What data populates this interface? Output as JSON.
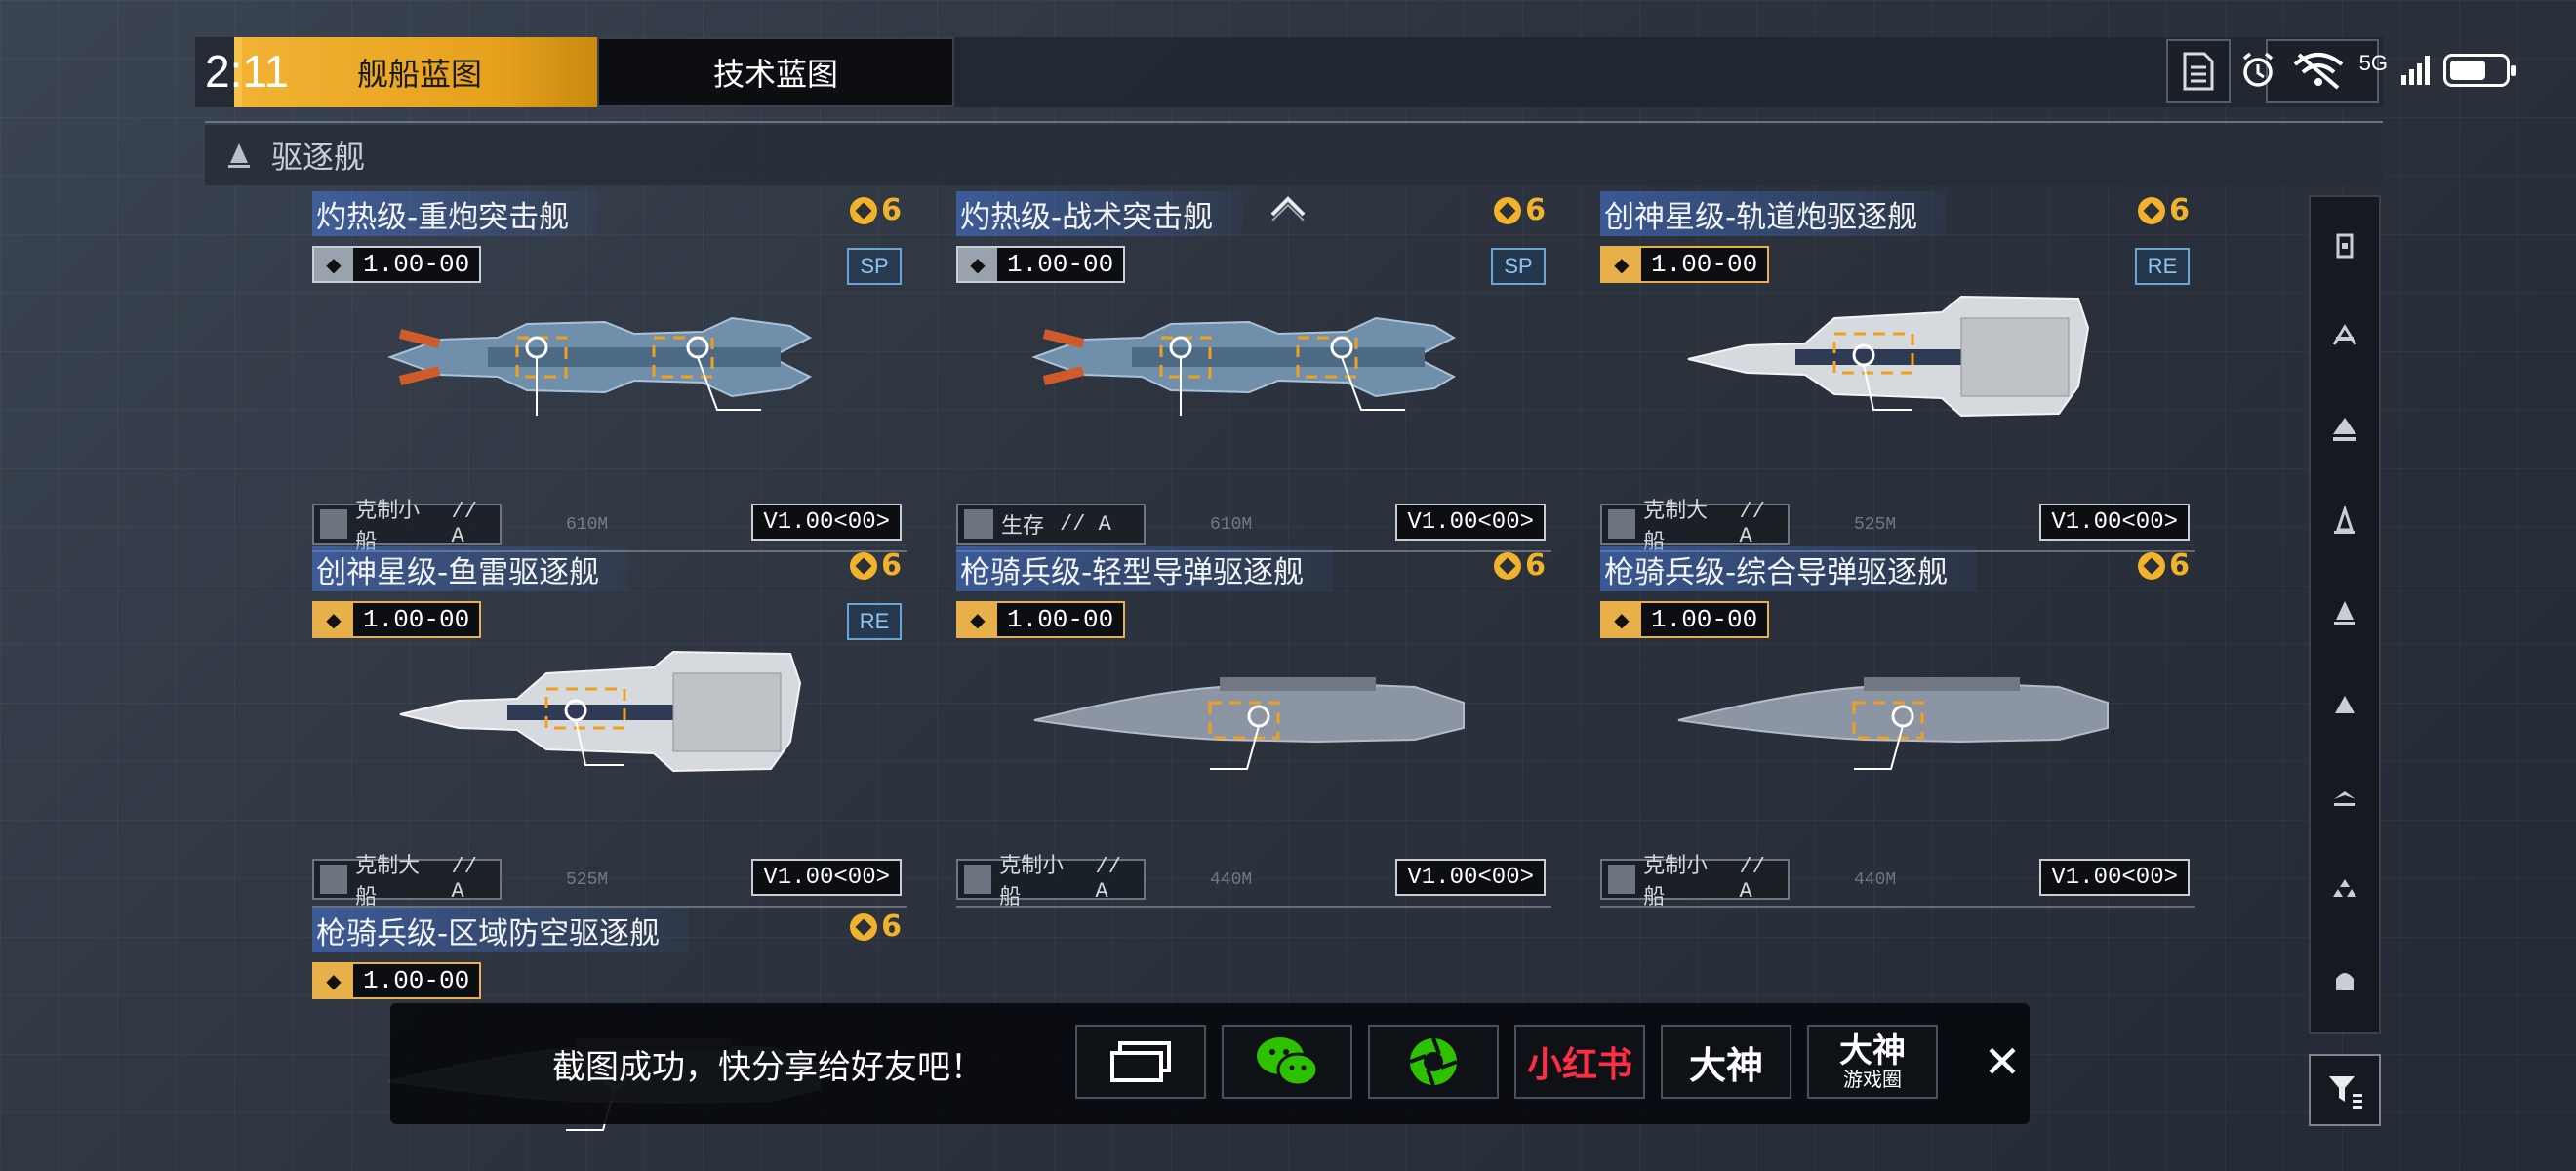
{
  "status_bar": {
    "time": "2:11",
    "network": "5G"
  },
  "tabs": {
    "ship_blueprint": "舰船蓝图",
    "tech_blueprint": "技术蓝图"
  },
  "section": {
    "title": "驱逐舰"
  },
  "cards": [
    {
      "name": "灼热级-重炮突击舰",
      "cost": "6",
      "version": "1.00-00",
      "rarity": "SP",
      "role": "克制小船",
      "role_grade": "// A",
      "length": "610M",
      "model": "V1.00<00>",
      "ship_style": "blue"
    },
    {
      "name": "灼热级-战术突击舰",
      "cost": "6",
      "version": "1.00-00",
      "rarity": "SP",
      "role": "生存",
      "role_grade": "// A",
      "length": "610M",
      "model": "V1.00<00>",
      "ship_style": "blue"
    },
    {
      "name": "创神星级-轨道炮驱逐舰",
      "cost": "6",
      "version": "1.00-00",
      "rarity": "RE",
      "role": "克制大船",
      "role_grade": "// A",
      "length": "525M",
      "model": "V1.00<00>",
      "ship_style": "white"
    },
    {
      "name": "创神星级-鱼雷驱逐舰",
      "cost": "6",
      "version": "1.00-00",
      "rarity": "RE",
      "role": "克制大船",
      "role_grade": "// A",
      "length": "525M",
      "model": "V1.00<00>",
      "ship_style": "white"
    },
    {
      "name": "枪骑兵级-轻型导弹驱逐舰",
      "cost": "6",
      "version": "1.00-00",
      "rarity": "",
      "role": "克制小船",
      "role_grade": "// A",
      "length": "440M",
      "model": "V1.00<00>",
      "ship_style": "grey"
    },
    {
      "name": "枪骑兵级-综合导弹驱逐舰",
      "cost": "6",
      "version": "1.00-00",
      "rarity": "",
      "role": "克制小船",
      "role_grade": "// A",
      "length": "440M",
      "model": "V1.00<00>",
      "ship_style": "grey"
    },
    {
      "name": "枪骑兵级-区域防空驱逐舰",
      "cost": "6",
      "version": "1.00-00",
      "rarity": "",
      "role": "",
      "role_grade": "",
      "length": "",
      "model": "",
      "ship_style": "grey"
    }
  ],
  "rail_icons": [
    "carrier-icon",
    "battlecruiser-icon",
    "cruiser-icon",
    "destroyer-icon",
    "frigate-icon",
    "corvette-icon",
    "fighter-icon",
    "squadron-icon",
    "hangar-icon"
  ],
  "share": {
    "message": "截图成功，快分享给好友吧！",
    "targets": [
      {
        "name": "screenshot-edit",
        "label": ""
      },
      {
        "name": "wechat",
        "label": ""
      },
      {
        "name": "moments",
        "label": ""
      },
      {
        "name": "xiaohongshu",
        "label": "小红书"
      },
      {
        "name": "dashen",
        "label": "大神"
      },
      {
        "name": "dashen-circle",
        "label": "大神",
        "sublabel": "游戏圈"
      }
    ],
    "close": "✕"
  },
  "colors": {
    "accent": "#e7a21e",
    "panel": "#1b2028",
    "rare_blue": "#8cc4f0",
    "cost_gold": "#f0b32b"
  }
}
